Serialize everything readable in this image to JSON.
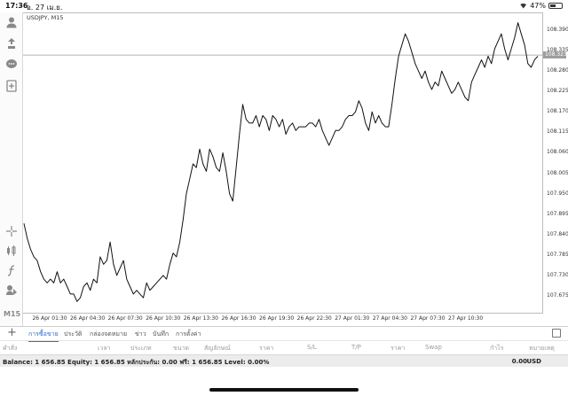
{
  "status_bar": {
    "time": "17:36",
    "date": "อ. 27 เม.ย.",
    "battery": "47%",
    "battery_level": 0.47
  },
  "chart": {
    "symbol": "USDJPY, M15",
    "current_price": "108.323",
    "timeframe": "M15",
    "line_color": "#111111"
  },
  "chart_data": {
    "type": "line",
    "price_ticks": [
      "108.390",
      "108.335",
      "108.280",
      "108.225",
      "108.170",
      "108.115",
      "108.060",
      "108.005",
      "107.950",
      "107.895",
      "107.840",
      "107.785",
      "107.730",
      "107.675"
    ],
    "time_labels": [
      "26 Apr 01:30",
      "26 Apr 04:30",
      "26 Apr 07:30",
      "26 Apr 10:30",
      "26 Apr 13:30",
      "26 Apr 16:30",
      "26 Apr 19:30",
      "26 Apr 22:30",
      "27 Apr 01:30",
      "27 Apr 04:30",
      "27 Apr 07:30",
      "27 Apr 10:30"
    ],
    "ylim": [
      107.645,
      108.425
    ],
    "x_index_range": [
      0,
      165
    ],
    "series": [
      {
        "values": [
          107.87,
          107.83,
          107.8,
          107.78,
          107.77,
          107.74,
          107.72,
          107.71,
          107.72,
          107.71,
          107.74,
          107.71,
          107.72,
          107.7,
          107.68,
          107.68,
          107.66,
          107.67,
          107.7,
          107.71,
          107.69,
          107.72,
          107.71,
          107.78,
          107.76,
          107.77,
          107.82,
          107.76,
          107.73,
          107.75,
          107.77,
          107.72,
          107.7,
          107.68,
          107.69,
          107.68,
          107.67,
          107.71,
          107.69,
          107.7,
          107.71,
          107.72,
          107.73,
          107.72,
          107.76,
          107.79,
          107.78,
          107.82,
          107.88,
          107.95,
          107.99,
          108.03,
          108.02,
          108.07,
          108.03,
          108.01,
          108.07,
          108.05,
          108.02,
          108.01,
          108.06,
          108.01,
          107.95,
          107.93,
          108.02,
          108.11,
          108.19,
          108.15,
          108.14,
          108.14,
          108.16,
          108.13,
          108.16,
          108.15,
          108.12,
          108.16,
          108.15,
          108.13,
          108.15,
          108.11,
          108.13,
          108.14,
          108.12,
          108.13,
          108.13,
          108.13,
          108.14,
          108.14,
          108.13,
          108.15,
          108.12,
          108.1,
          108.08,
          108.1,
          108.12,
          108.12,
          108.13,
          108.15,
          108.16,
          108.16,
          108.17,
          108.2,
          108.18,
          108.14,
          108.12,
          108.17,
          108.14,
          108.16,
          108.14,
          108.13,
          108.13,
          108.19,
          108.26,
          108.32,
          108.35,
          108.38,
          108.36,
          108.33,
          108.3,
          108.28,
          108.26,
          108.28,
          108.25,
          108.23,
          108.25,
          108.24,
          108.28,
          108.26,
          108.24,
          108.22,
          108.23,
          108.25,
          108.23,
          108.21,
          108.2,
          108.25,
          108.27,
          108.29,
          108.31,
          108.29,
          108.32,
          108.3,
          108.34,
          108.36,
          108.38,
          108.34,
          108.31,
          108.34,
          108.37,
          108.41,
          108.38,
          108.35,
          108.3,
          108.29,
          108.31,
          108.32
        ]
      }
    ]
  },
  "bottom_tabs": [
    {
      "label": "การซื้อขาย",
      "active": true
    },
    {
      "label": "ประวัติ",
      "active": false
    },
    {
      "label": "กล่องจดหมาย",
      "active": false
    },
    {
      "label": "ข่าว",
      "active": false
    },
    {
      "label": "บันทึก",
      "active": false
    },
    {
      "label": "การตั้งค่า",
      "active": false
    }
  ],
  "columns": [
    "คำสั่ง",
    "เวลา",
    "ประเภท",
    "ขนาด",
    "สัญลักษณ์",
    "ราคา",
    "S/L",
    "T/P",
    "ราคา",
    "Swap",
    "กำไร",
    "หมายเหตุ"
  ],
  "account": {
    "summary": "Balance: 1 656.85 Equity: 1 656.85 หลักประกัน: 0.00 ฟรี: 1 656.85 Level: 0.00%",
    "profit": "0.00",
    "currency": "USD"
  }
}
